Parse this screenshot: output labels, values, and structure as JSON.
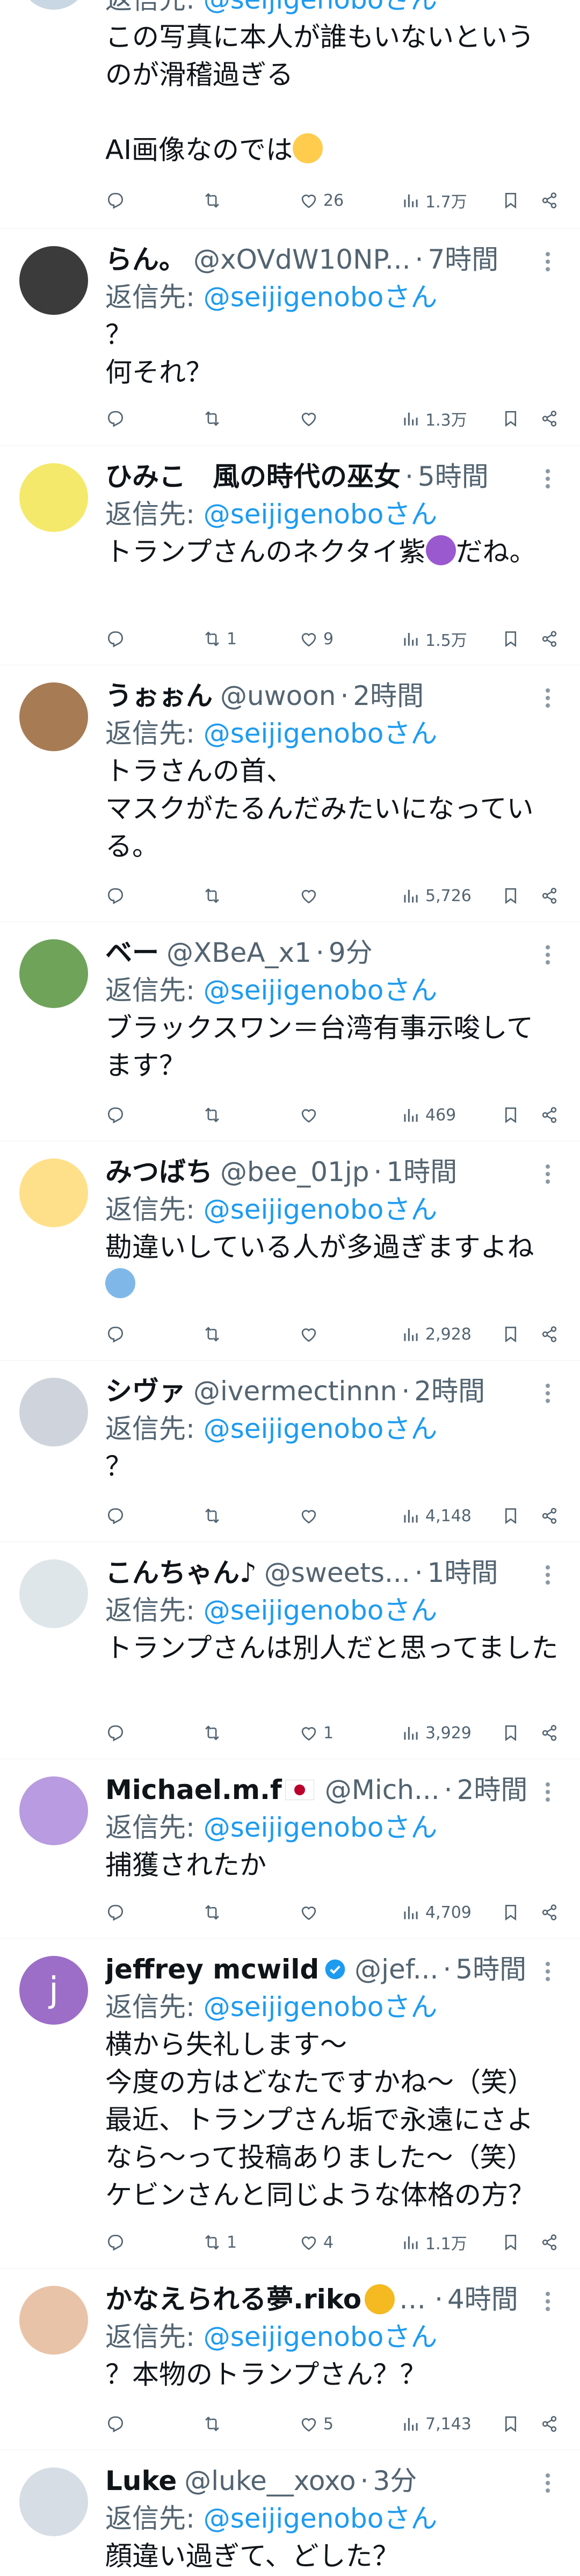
{
  "tweets": [
    {
      "reply_prefix": "返信先: ",
      "reply_to": "@seijigenoboさん",
      "text": "この写真に本人が誰もいないというのが滑稽過ぎる\n\nAI画像なのでは",
      "emoji": "thinking-face",
      "stats": {
        "reply": "",
        "retweet": "",
        "like": "26",
        "views": "1.7万"
      }
    },
    {
      "name": "らん。",
      "handle": "@xOVdW10NP...",
      "time": "7時間",
      "reply_prefix": "返信先: ",
      "reply_to": "@seijigenoboさん",
      "text": "？\n何それ？",
      "stats": {
        "reply": "",
        "retweet": "",
        "like": "",
        "views": "1.3万"
      }
    },
    {
      "name": "ひみこ　風の時代の巫女",
      "handle": "",
      "time": "5時間",
      "reply_prefix": "返信先: ",
      "reply_to": "@seijigenoboさん",
      "text": "トランプさんのネクタイ紫",
      "text_after": "だね。",
      "emoji": "purple-circle",
      "stats": {
        "reply": "",
        "retweet": "1",
        "like": "9",
        "views": "1.5万"
      }
    },
    {
      "name": "うぉぉん",
      "handle": "@uwoon",
      "time": "2時間",
      "reply_prefix": "返信先: ",
      "reply_to": "@seijigenoboさん",
      "text": "トラさんの首、\nマスクがたるんだみたいになっている。",
      "stats": {
        "reply": "",
        "retweet": "",
        "like": "",
        "views": "5,726"
      }
    },
    {
      "name": "ベー",
      "handle": "@XBeA_x1",
      "time": "9分",
      "reply_prefix": "返信先: ",
      "reply_to": "@seijigenoboさん",
      "text": "ブラックスワン＝台湾有事示唆してます？",
      "stats": {
        "reply": "",
        "retweet": "",
        "like": "",
        "views": "469"
      }
    },
    {
      "name": "みつばち",
      "handle": "@bee_01jp",
      "time": "1時間",
      "reply_prefix": "返信先: ",
      "reply_to": "@seijigenoboさん",
      "text": "勘違いしている人が多過ぎますよね",
      "emoji": "anxious-face",
      "stats": {
        "reply": "",
        "retweet": "",
        "like": "",
        "views": "2,928"
      }
    },
    {
      "name": "シヴァ",
      "handle": "@ivermectinnn",
      "time": "2時間",
      "reply_prefix": "返信先: ",
      "reply_to": "@seijigenoboさん",
      "text": "？",
      "stats": {
        "reply": "",
        "retweet": "",
        "like": "",
        "views": "4,148"
      }
    },
    {
      "name": "こんちゃん♪",
      "handle": "@sweets...",
      "time": "1時間",
      "reply_prefix": "返信先: ",
      "reply_to": "@seijigenoboさん",
      "text": "トランプさんは別人だと思ってました",
      "stats": {
        "reply": "",
        "retweet": "",
        "like": "1",
        "views": "3,929"
      }
    },
    {
      "name": "Michael.m.f",
      "handle": "@Mich...",
      "time": "2時間",
      "reply_prefix": "返信先: ",
      "reply_to": "@seijigenoboさん",
      "text": "捕獲されたか",
      "stats": {
        "reply": "",
        "retweet": "",
        "like": "",
        "views": "4,709"
      }
    },
    {
      "name": "jeffrey mcwild",
      "handle": "@jef...",
      "time": "5時間",
      "avatar_letter": "j",
      "reply_prefix": "返信先: ",
      "reply_to": "@seijigenoboさん",
      "text": "横から失礼します〜\n今度の方はどなたですかね〜（笑）\n最近、トランプさん垢で永遠にさよなら〜って投稿ありました〜（笑）\nケビンさんと同じような体格の方？",
      "stats": {
        "reply": "",
        "retweet": "1",
        "like": "4",
        "views": "1.1万"
      }
    },
    {
      "name": "かなえられる夢.riko",
      "handle": "",
      "time": "4時間",
      "reply_prefix": "返信先: ",
      "reply_to": "@seijigenoboさん",
      "text": "？本物のトランプさん？？",
      "stats": {
        "reply": "",
        "retweet": "",
        "like": "5",
        "views": "7,143"
      }
    },
    {
      "name": "Luke",
      "handle": "@luke__xoxo",
      "time": "3分",
      "reply_prefix": "返信先: ",
      "reply_to": "@seijigenoboさん",
      "text": "顔違い過ぎて、どした？"
    }
  ]
}
